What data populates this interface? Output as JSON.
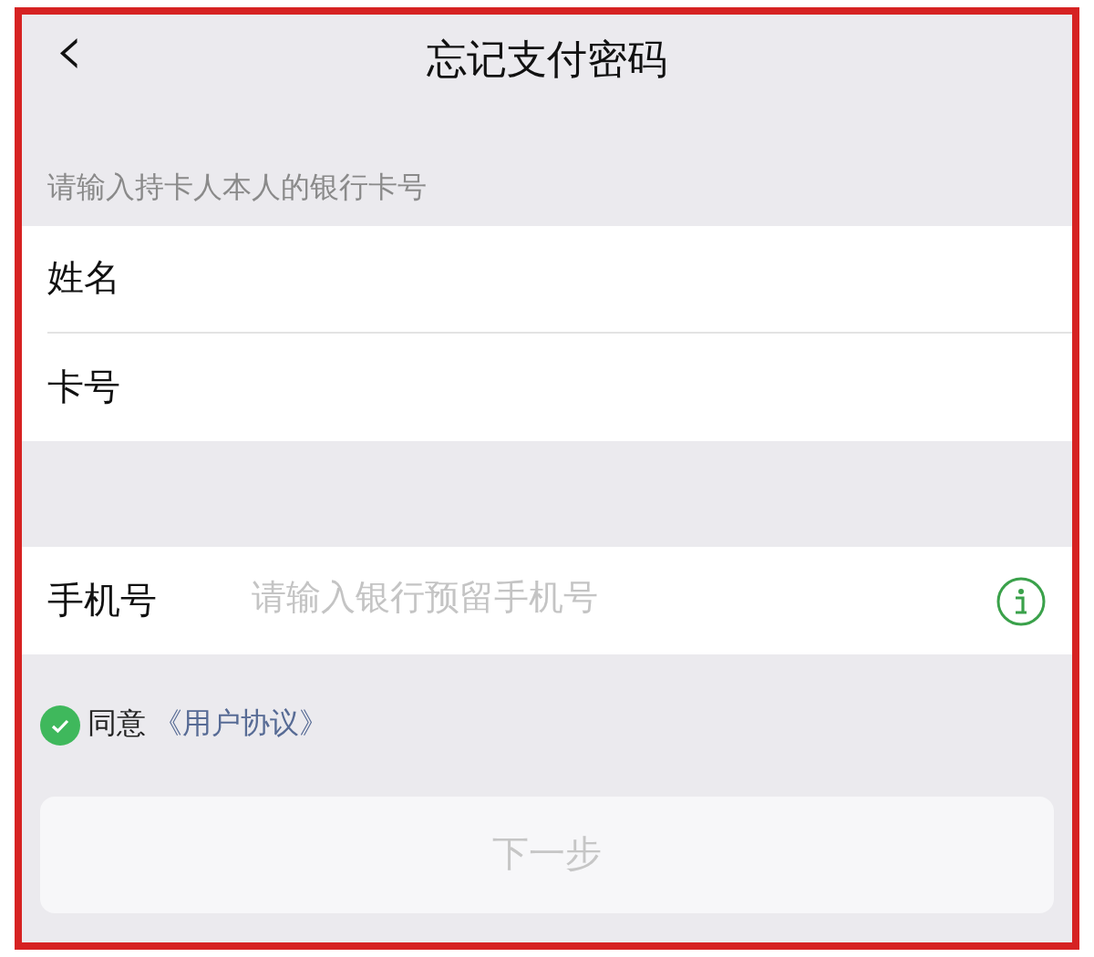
{
  "nav": {
    "back": "‹",
    "title": "忘记支付密码"
  },
  "section_hint": "请输入持卡人本人的银行卡号",
  "card_fields": [
    {
      "label": "姓名"
    },
    {
      "label": "卡号"
    }
  ],
  "phone_field": {
    "label": "手机号",
    "placeholder": "请输入银行预留手机号"
  },
  "agreement": {
    "checked": true,
    "prefix": "同意",
    "link": "《用户协议》"
  },
  "next_button": {
    "label": "下一步",
    "disabled": true
  }
}
